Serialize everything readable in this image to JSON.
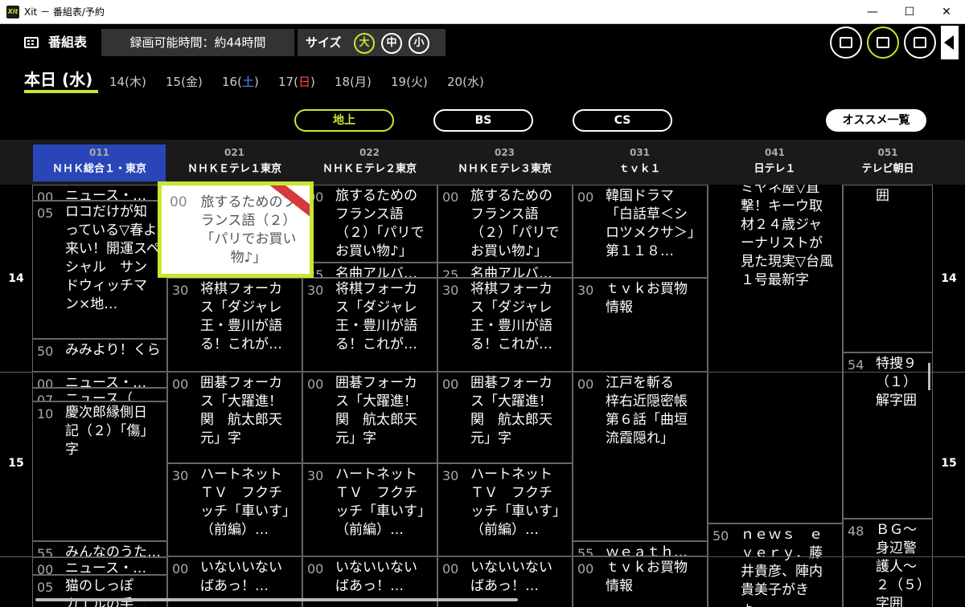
{
  "window": {
    "icon_text": "Xit",
    "title": "Xit － 番組表/予約",
    "min": "—",
    "max": "☐",
    "close": "✕"
  },
  "header": {
    "title": "番組表",
    "record_time": "録画可能時間：約44時間",
    "size_label": "サイズ",
    "sizes": [
      "大",
      "中",
      "小"
    ],
    "selected_size": "大",
    "right_buttons": [
      "tv-icon",
      "program-guide-icon",
      "playlist-icon"
    ]
  },
  "dates": {
    "today": "本日 (水)",
    "days": [
      {
        "num": "14(",
        "wd": "木",
        "close": ")",
        "color": "normal"
      },
      {
        "num": "15(",
        "wd": "金",
        "close": ")",
        "color": "normal"
      },
      {
        "num": "16(",
        "wd": "土",
        "close": ")",
        "color": "blue"
      },
      {
        "num": "17(",
        "wd": "日",
        "close": ")",
        "color": "red"
      },
      {
        "num": "18(",
        "wd": "月",
        "close": ")",
        "color": "normal"
      },
      {
        "num": "19(",
        "wd": "火",
        "close": ")",
        "color": "normal"
      },
      {
        "num": "20(",
        "wd": "水",
        "close": ")",
        "color": "normal"
      }
    ]
  },
  "broadcast_tabs": [
    "地上",
    "BS",
    "CS"
  ],
  "active_tab": "地上",
  "recommend": "オススメ一覧",
  "channels": [
    {
      "num": "011",
      "name": "ＮＨＫ総合１・東京"
    },
    {
      "num": "021",
      "name": "ＮＨＫＥテレ１東京"
    },
    {
      "num": "022",
      "name": "ＮＨＫＥテレ２東京"
    },
    {
      "num": "023",
      "name": "ＮＨＫＥテレ３東京"
    },
    {
      "num": "031",
      "name": "ｔｖｋ１"
    },
    {
      "num": "041",
      "name": "日テレ１"
    },
    {
      "num": "051",
      "name": "テレビ朝日"
    }
  ],
  "hours": [
    "14",
    "15"
  ],
  "programs": {
    "c0": [
      {
        "m": "00",
        "t": "ニュース・…"
      },
      {
        "m": "05",
        "t": "ロコだけが知っている▽春よ来い！開運スペシャル　サンドウィッチマン×地…"
      },
      {
        "m": "50",
        "t": "みみより！くらし解説「…"
      },
      {
        "m": "00",
        "t": "ニュース・…"
      },
      {
        "m": "07",
        "t": "ニュース（…"
      },
      {
        "m": "10",
        "t": "慶次郎縁側日記（２）「傷」字"
      },
      {
        "m": "55",
        "t": "みんなのうた…"
      },
      {
        "m": "00",
        "t": "ニュース・…"
      },
      {
        "m": "05",
        "t": "猫のしっぽ　カエルの手…"
      }
    ],
    "c1": [
      {
        "m": "00",
        "t": "旅するためのフランス語（２）「パリでお買い物♪」"
      },
      {
        "m": "30",
        "t": "将棋フォーカス「ダジャレ王・豊川が語る！これが…"
      },
      {
        "m": "00",
        "t": "囲碁フォーカス「大躍進！関　航太郎天元」字"
      },
      {
        "m": "30",
        "t": "ハートネットＴＶ　フクチッチ「車いす」（前編）…"
      },
      {
        "m": "00",
        "t": "いないいないばあっ！…"
      }
    ],
    "c2": [
      {
        "m": "00",
        "t": "旅するためのフランス語（２）「パリでお買い物♪」"
      },
      {
        "m": "25",
        "t": "名曲アルバ…"
      },
      {
        "m": "30",
        "t": "将棋フォーカス「ダジャレ王・豊川が語る！これが…"
      },
      {
        "m": "00",
        "t": "囲碁フォーカス「大躍進！関　航太郎天元」字"
      },
      {
        "m": "30",
        "t": "ハートネットＴＶ　フクチッチ「車いす」（前編）…"
      },
      {
        "m": "00",
        "t": "いないいないばあっ！…"
      }
    ],
    "c3": [
      {
        "m": "00",
        "t": "旅するためのフランス語（２）「パリでお買い物♪」"
      },
      {
        "m": "25",
        "t": "名曲アルバ…"
      },
      {
        "m": "30",
        "t": "将棋フォーカス「ダジャレ王・豊川が語る！これが…"
      },
      {
        "m": "00",
        "t": "囲碁フォーカス「大躍進！関　航太郎天元」字"
      },
      {
        "m": "30",
        "t": "ハートネットＴＶ　フクチッチ「車いす」（前編）…"
      },
      {
        "m": "00",
        "t": "いないいないばあっ！…"
      }
    ],
    "c4": [
      {
        "m": "00",
        "t": "韓国ドラマ「白話草＜シロツメクサ＞」　第１１８…"
      },
      {
        "m": "30",
        "t": "ｔｖｋお買物情報"
      },
      {
        "m": "00",
        "t": "江戸を斬る　梓右近隠密帳　第６話「曲垣流霞隠れ」"
      },
      {
        "m": "55",
        "t": "ｗｅａｔｈ…"
      },
      {
        "m": "00",
        "t": "ｔｖｋお買物情報"
      }
    ],
    "c5": [
      {
        "m": "",
        "t": "ミヤネ屋▽直撃！キーウ取材２４歳ジャーナリストが見た現実▽台風１号最新字"
      },
      {
        "m": "50",
        "t": "ｎｅｗｓ　ｅｖｅｒｙ．藤井貴彦、陣内貴美子がきょ…"
      }
    ],
    "c6": [
      {
        "m": "",
        "t": "囲"
      },
      {
        "m": "54",
        "t": "特捜９（１）解字囲"
      },
      {
        "m": "48",
        "t": "ＢＧ～身辺警護人～２（５）字囲"
      }
    ]
  }
}
